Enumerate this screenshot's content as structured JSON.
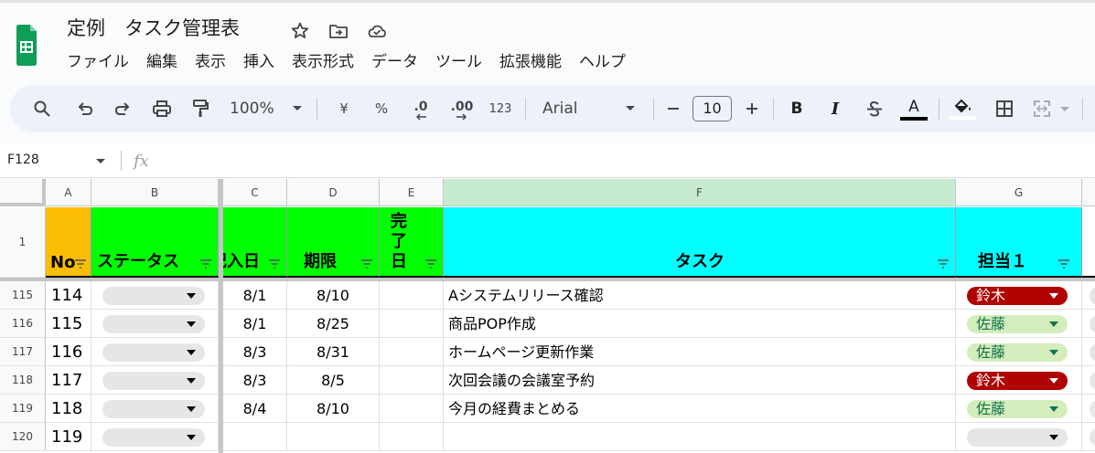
{
  "document": {
    "title": "定例　タスク管理表"
  },
  "menu": [
    "ファイル",
    "編集",
    "表示",
    "挿入",
    "表示形式",
    "データ",
    "ツール",
    "拡張機能",
    "ヘルプ"
  ],
  "toolbar": {
    "zoom": "100%",
    "currency": "¥",
    "percent": "%",
    "decimal_decrease": ".0",
    "decimal_increase": ".00",
    "number_format": "123",
    "font": "Arial",
    "font_size": "10",
    "bold": "B",
    "italic": "I",
    "text_color_glyph": "A"
  },
  "formula_bar": {
    "name_box": "F128",
    "fx": "fx"
  },
  "columns": [
    "A",
    "B",
    "C",
    "D",
    "E",
    "F",
    "G"
  ],
  "header_row": {
    "row_number": "1",
    "no": "No",
    "status": "ステータス",
    "entry_date": "記入日",
    "deadline": "期限",
    "done_date": "完了日",
    "task": "タスク",
    "owner": "担当１"
  },
  "rows": [
    {
      "row": "115",
      "no": "114",
      "entry": "8/1",
      "deadline": "8/10",
      "task": "Aシステムリリース確認",
      "owner": "鈴木",
      "owner_style": "red"
    },
    {
      "row": "116",
      "no": "115",
      "entry": "8/1",
      "deadline": "8/25",
      "task": "商品POP作成",
      "owner": "佐藤",
      "owner_style": "green"
    },
    {
      "row": "117",
      "no": "116",
      "entry": "8/3",
      "deadline": "8/31",
      "task": "ホームページ更新作業",
      "owner": "佐藤",
      "owner_style": "green"
    },
    {
      "row": "118",
      "no": "117",
      "entry": "8/3",
      "deadline": "8/5",
      "task": "次回会議の会議室予約",
      "owner": "鈴木",
      "owner_style": "red"
    },
    {
      "row": "119",
      "no": "118",
      "entry": "8/4",
      "deadline": "8/10",
      "task": "今月の経費まとめる",
      "owner": "佐藤",
      "owner_style": "green"
    },
    {
      "row": "120",
      "no": "119",
      "entry": "",
      "deadline": "",
      "task": "",
      "owner": "",
      "owner_style": "grey"
    }
  ],
  "colors": {
    "no_header": "#fbbc04",
    "status_header": "#00ff00",
    "task_header": "#00ffff",
    "owner_red": "#b10202",
    "owner_green": "#d4edbc",
    "sheets_green": "#0f9d58"
  }
}
